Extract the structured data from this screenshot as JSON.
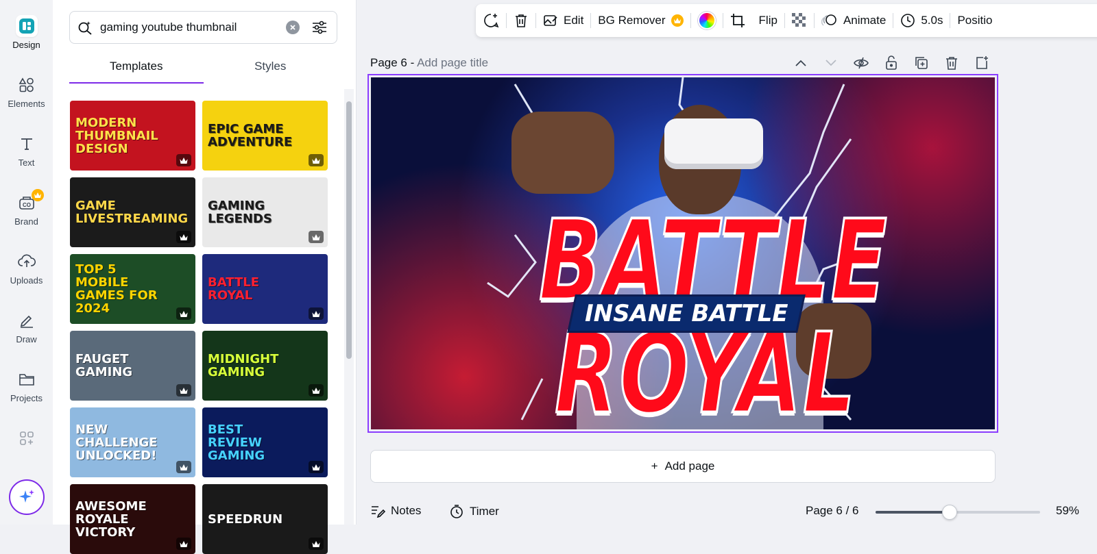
{
  "rail": {
    "items": [
      {
        "label": "Design"
      },
      {
        "label": "Elements"
      },
      {
        "label": "Text"
      },
      {
        "label": "Brand"
      },
      {
        "label": "Uploads"
      },
      {
        "label": "Draw"
      },
      {
        "label": "Projects"
      }
    ]
  },
  "search": {
    "value": "gaming youtube thumbnail"
  },
  "tabs": [
    {
      "label": "Templates"
    },
    {
      "label": "Styles"
    }
  ],
  "templates": [
    {
      "text": "Modern Thumbnail Design",
      "bg": "#c3131f",
      "fg": "#ffe14a"
    },
    {
      "text": "Epic Game Adventure",
      "bg": "#f5d20f",
      "fg": "#1a1a1a"
    },
    {
      "text": "Game Livestreaming",
      "bg": "#1b1b1b",
      "fg": "#ffd84a"
    },
    {
      "text": "Gaming Legends",
      "bg": "#e9e9e9",
      "fg": "#1a1a1a"
    },
    {
      "text": "Top 5 Mobile Games For 2024",
      "bg": "#1d4d26",
      "fg": "#ffd400"
    },
    {
      "text": "Battle Royal",
      "bg": "#1e2a7c",
      "fg": "#ff2030"
    },
    {
      "text": "Fauget Gaming",
      "bg": "#5a6a7a",
      "fg": "#ffffff"
    },
    {
      "text": "Midnight Gaming",
      "bg": "#14361a",
      "fg": "#d8ff3a"
    },
    {
      "text": "New Challenge Unlocked!",
      "bg": "#8fb9e0",
      "fg": "#ffffff"
    },
    {
      "text": "Best Review Gaming",
      "bg": "#0b1b5c",
      "fg": "#46d2ff"
    },
    {
      "text": "Awesome Royale Victory",
      "bg": "#2a0b0b",
      "fg": "#ffffff"
    },
    {
      "text": "Speedrun",
      "bg": "#1a1a1a",
      "fg": "#ffffff"
    }
  ],
  "toolbar": {
    "edit": "Edit",
    "bg_remover": "BG Remover",
    "flip": "Flip",
    "animate": "Animate",
    "duration": "5.0s",
    "position": "Positio"
  },
  "page_head": {
    "page": "Page 6 - ",
    "placeholder": "Add page title"
  },
  "canvas": {
    "title1": "BATTLE",
    "banner": "INSANE BATTLE",
    "title2": "ROYAL"
  },
  "add_page": {
    "label": "Add page"
  },
  "footer": {
    "notes": "Notes",
    "timer": "Timer",
    "page_indicator": "Page 6 / 6",
    "zoom": "59%",
    "zoom_fraction": 0.45
  },
  "colors": {
    "accent": "#8b3dff",
    "crown": "#ffb400"
  }
}
